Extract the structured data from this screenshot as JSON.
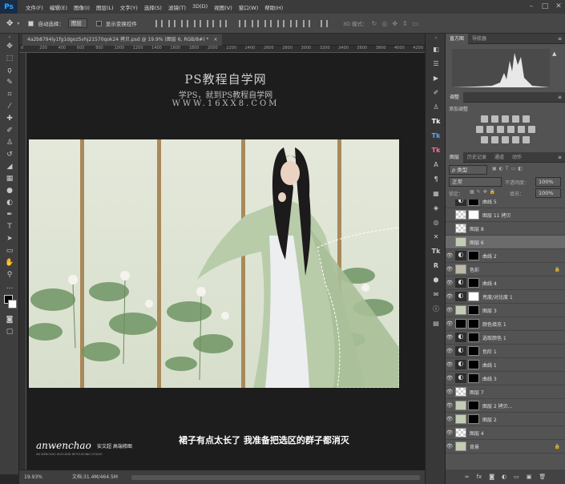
{
  "app": {
    "logo": "Ps"
  },
  "menubar": [
    "文件(F)",
    "编辑(E)",
    "图像(I)",
    "图层(L)",
    "文字(Y)",
    "选择(S)",
    "滤镜(T)",
    "3D(D)",
    "视图(V)",
    "窗口(W)",
    "帮助(H)"
  ],
  "options": {
    "auto_select_label": "自动选择：",
    "auto_select_value": "图层",
    "show_transform_label": "显示变换控件",
    "mode3d_label": "3D 模式："
  },
  "document": {
    "tab_title": "4a2b8794ly1fg1dgoz5vhj21570qok24 拷贝.psd @ 19.9% (图层 6, RGB/8#) *"
  },
  "ruler_ticks": [
    "0",
    "200",
    "400",
    "600",
    "800",
    "1000",
    "1200",
    "1400",
    "1600",
    "1800",
    "2000",
    "2200",
    "2400",
    "2600",
    "2800",
    "3000",
    "3200",
    "3400",
    "3600",
    "3800",
    "4000",
    "4200"
  ],
  "watermark": {
    "title": "PS教程自学网",
    "subtitle": "学PS，就到PS教程自学网",
    "url": "WWW.16XX8.COM"
  },
  "caption": "裙子有点太长了 我准备把选区的群子都消灭",
  "signature": {
    "name": "anwenchao",
    "cn": "安文超 高端修图",
    "small": "AN WENCHAO HIGH-END RETOUCHING STUDIO"
  },
  "status": {
    "zoom": "19.93%",
    "doc": "文档:31.4M/464.5M"
  },
  "histogram": {
    "tabs": [
      "直方图",
      "导航器"
    ]
  },
  "adjustments": {
    "tab": "调整",
    "add_label": "添加调整"
  },
  "layers_panel": {
    "tabs": [
      "图层",
      "历史记录",
      "通道",
      "动作"
    ],
    "filter_label": "ρ 类型",
    "blend_mode": "正常",
    "opacity_label": "不透明度：",
    "opacity_value": "100%",
    "lock_label": "锁定：",
    "fill_label": "填充：",
    "fill_value": "100%",
    "layers": [
      {
        "name": "曲线 5",
        "thumb": "adj",
        "mask": "black",
        "eye": false,
        "partial": true
      },
      {
        "name": "图层 11 拷贝",
        "thumb": "trans",
        "mask": "white",
        "eye": false
      },
      {
        "name": "图层 8",
        "thumb": "trans",
        "mask": "none",
        "eye": false
      },
      {
        "name": "图层 6",
        "thumb": "photo",
        "mask": "none",
        "eye": false,
        "selected": true
      },
      {
        "name": "曲线 2",
        "thumb": "adj",
        "mask": "black",
        "eye": true
      },
      {
        "name": "色彩",
        "thumb": "solid",
        "mask": "none",
        "eye": true,
        "lock": true
      },
      {
        "name": "曲线 4",
        "thumb": "adj",
        "mask": "black",
        "eye": true
      },
      {
        "name": "亮度/对比度 1",
        "thumb": "adj",
        "mask": "white",
        "eye": true
      },
      {
        "name": "图层 3",
        "thumb": "photo",
        "mask": "black",
        "eye": true
      },
      {
        "name": "颜色填充 1",
        "thumb": "black",
        "mask": "black",
        "eye": true
      },
      {
        "name": "选取颜色 1",
        "thumb": "adj",
        "mask": "black",
        "eye": true
      },
      {
        "name": "色阶 1",
        "thumb": "adj",
        "mask": "black",
        "eye": true
      },
      {
        "name": "曲线 1",
        "thumb": "adj",
        "mask": "black",
        "eye": true
      },
      {
        "name": "曲线 3",
        "thumb": "adj",
        "mask": "black",
        "eye": true
      },
      {
        "name": "图层 7",
        "thumb": "trans",
        "mask": "none",
        "eye": true
      },
      {
        "name": "图层 2 拷贝...",
        "thumb": "photo",
        "mask": "black",
        "eye": true
      },
      {
        "name": "图层 2",
        "thumb": "photo",
        "mask": "black",
        "eye": true
      },
      {
        "name": "图层 4",
        "thumb": "trans",
        "mask": "none",
        "eye": true
      },
      {
        "name": "背景",
        "thumb": "photo",
        "mask": "none",
        "eye": true,
        "lock": true
      }
    ]
  },
  "colors": {
    "accent": "#31a8ff",
    "panel": "#535353",
    "canvas_bg": "#1d1d1d"
  }
}
